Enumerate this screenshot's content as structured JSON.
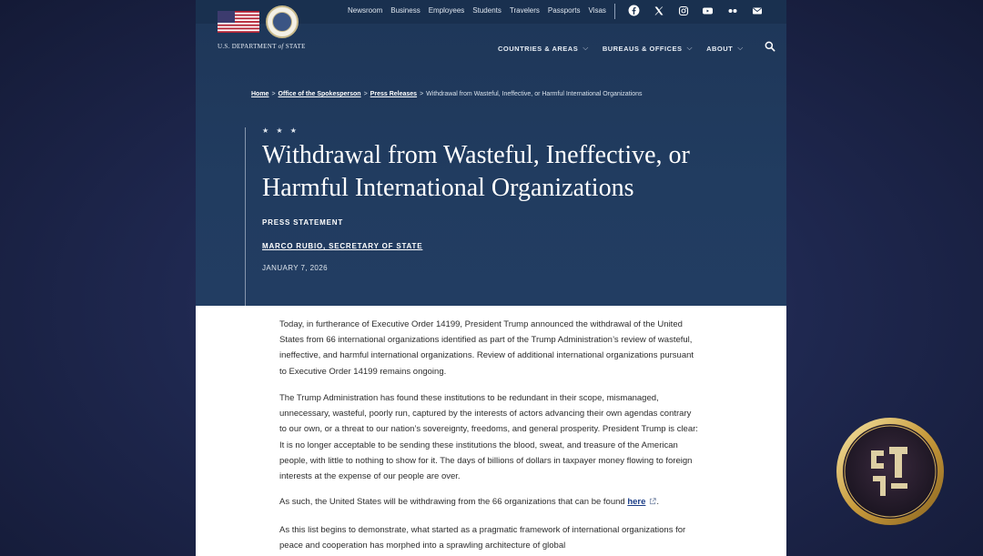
{
  "utility_nav": [
    "Newsroom",
    "Business",
    "Employees",
    "Students",
    "Travelers",
    "Passports",
    "Visas"
  ],
  "social_icons": [
    "facebook-icon",
    "x-icon",
    "instagram-icon",
    "youtube-icon",
    "flickr-icon",
    "email-icon"
  ],
  "brand": {
    "name_prefix": "U.S. DEPARTMENT ",
    "name_of": "of",
    "name_suffix": " STATE"
  },
  "main_nav": [
    {
      "label": "COUNTRIES & AREAS"
    },
    {
      "label": "BUREAUS & OFFICES"
    },
    {
      "label": "ABOUT"
    }
  ],
  "breadcrumb": {
    "items": [
      "Home",
      "Office of the Spokesperson",
      "Press Releases"
    ],
    "separator": ">",
    "current": "Withdrawal from Wasteful, Ineffective, or Harmful International Organizations"
  },
  "article": {
    "stars": "★ ★ ★",
    "title": "Withdrawal from Wasteful, Ineffective, or Harmful International Organizations",
    "type": "PRESS STATEMENT",
    "author": "MARCO RUBIO, SECRETARY OF STATE",
    "date": "JANUARY 7, 2026",
    "p1": "Today, in furtherance of Executive Order 14199, President Trump announced the withdrawal of the United States from 66 international organizations identified as part of the Trump Administration’s review of wasteful, ineffective, and harmful international organizations. Review of additional international organizations pursuant to Executive Order 14199 remains ongoing.",
    "p2": "The Trump Administration has found these institutions to be redundant in their scope, mismanaged, unnecessary, wasteful, poorly run, captured by the interests of actors advancing their own agendas contrary to our own, or a threat to our nation’s sovereignty, freedoms, and general prosperity. President Trump is clear: It is no longer acceptable to be sending these institutions the blood, sweat, and treasure of the American people, with little to nothing to show for it. The days of billions of dollars in taxpayer money flowing to foreign interests at the expense of our people are over.",
    "p3_text": "As such, the United States will be withdrawing from the 66 organizations that can be found ",
    "p3_link": "here",
    "p3_end": ".",
    "p4": "As this list begins to demonstrate, what started as a pragmatic framework of international organizations for peace and cooperation has morphed into a sprawling architecture of global"
  },
  "colors": {
    "hero": "#213c60",
    "link": "#1a3c86",
    "background": "#1f2850"
  }
}
